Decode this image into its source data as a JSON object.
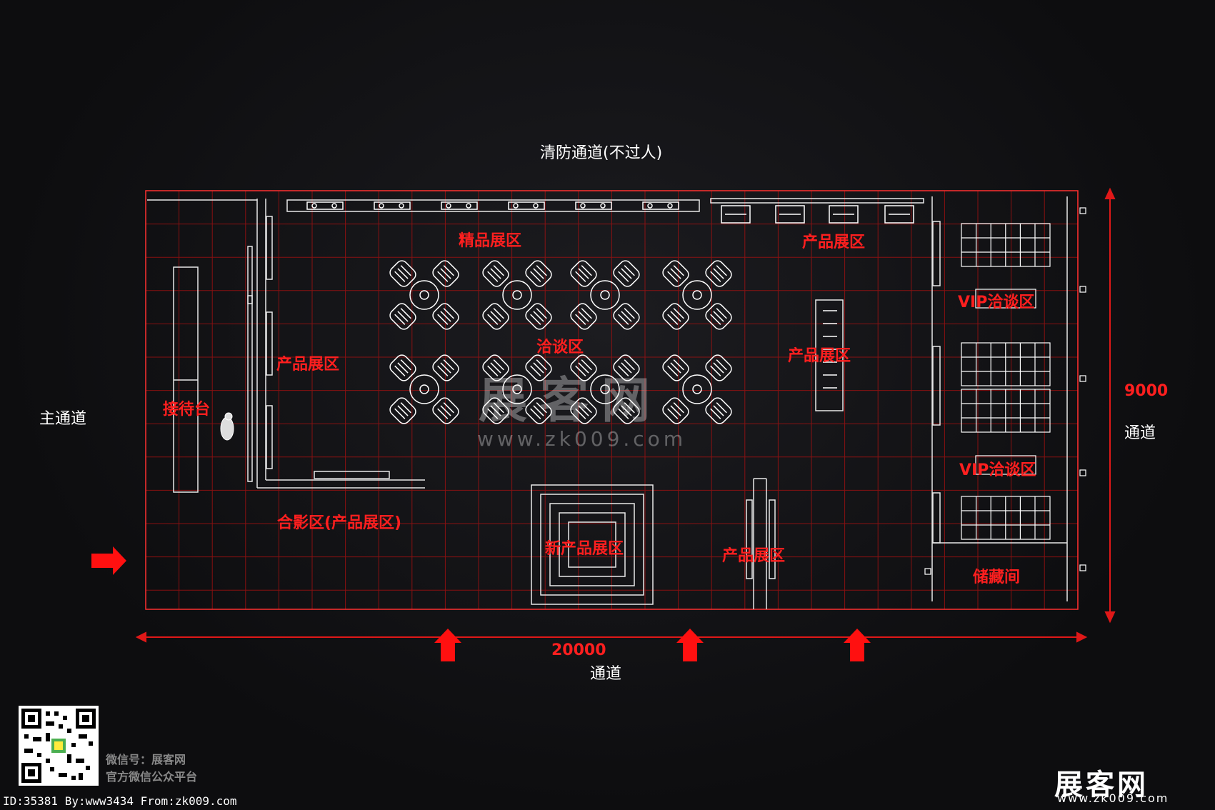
{
  "top_label": "清防通道(不过人)",
  "left_label": "主通道",
  "right_dimension": "9000",
  "right_label": "通道",
  "bottom_dimension": "20000",
  "bottom_label": "通道",
  "zones": {
    "reception": "接待台",
    "product_left": "产品展区",
    "premium": "精品展区",
    "negotiation": "洽谈区",
    "product_top_right": "产品展区",
    "product_mid_right": "产品展区",
    "vip_1": "VIP洽谈区",
    "vip_2": "VIP洽谈区",
    "photo": "合影区(产品展区)",
    "new_product": "新产品展区",
    "product_bottom": "产品展区",
    "storage": "储藏间"
  },
  "watermark": {
    "text": "展客网",
    "url": "www.zk009.com"
  },
  "footer": {
    "id_line": "ID:35381 By:www3434 From:zk009.com",
    "wechat_line1": "微信号：展客网",
    "wechat_line2": "官方微信公众平台",
    "brand": "展客网",
    "brand_url": "www.zk009.com"
  },
  "colors": {
    "accent": "#ff1f1f",
    "line": "#ffffff",
    "background": "#0d0d0f"
  }
}
